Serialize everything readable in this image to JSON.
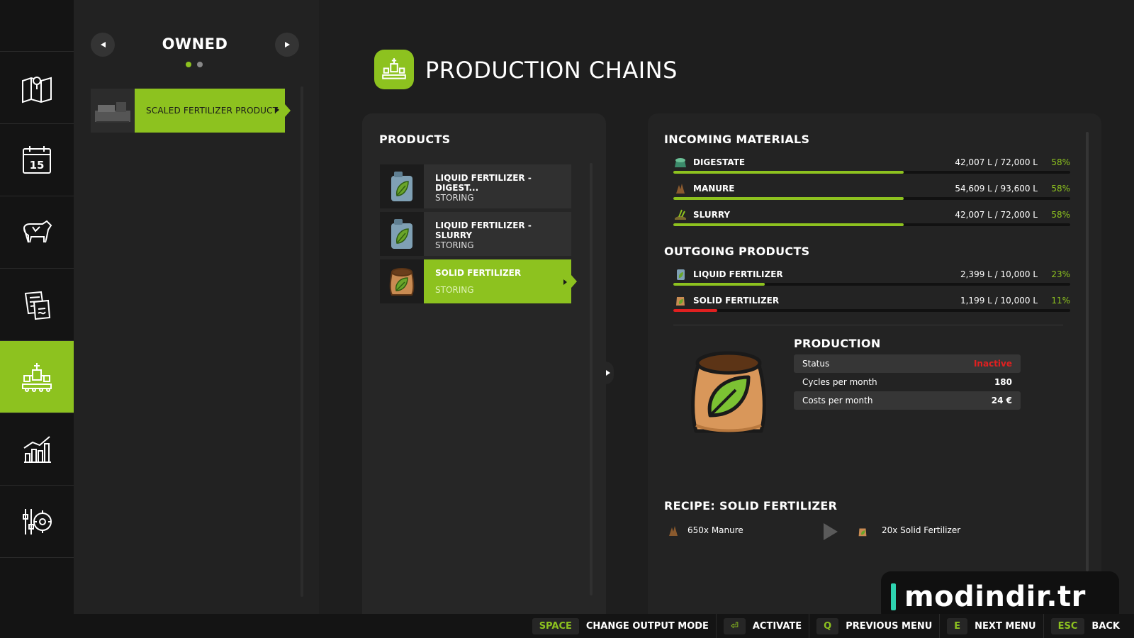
{
  "sidebar": {
    "items": [
      {
        "icon": "map-icon"
      },
      {
        "icon": "calendar-icon",
        "text": "15"
      },
      {
        "icon": "cow-icon"
      },
      {
        "icon": "contracts-icon"
      },
      {
        "icon": "production-icon"
      },
      {
        "icon": "statistics-icon"
      },
      {
        "icon": "settings-icon"
      }
    ],
    "active_index": 4
  },
  "owned": {
    "title": "OWNED",
    "page_count": 2,
    "active_page": 1,
    "item_label": "SCALED FERTILIZER PRODUCT"
  },
  "header": {
    "title": "PRODUCTION CHAINS"
  },
  "products": {
    "title": "PRODUCTS",
    "items": [
      {
        "name": "LIQUID FERTILIZER - DIGEST...",
        "status": "STORING",
        "icon": "liquid-fertilizer-icon"
      },
      {
        "name": "LIQUID FERTILIZER - SLURRY",
        "status": "STORING",
        "icon": "liquid-fertilizer-icon"
      },
      {
        "name": "SOLID FERTILIZER",
        "status": "STORING",
        "icon": "solid-fertilizer-icon",
        "active": true
      }
    ]
  },
  "incoming": {
    "title": "INCOMING MATERIALS",
    "items": [
      {
        "name": "DIGESTATE",
        "amount": "42,007 L / 72,000 L",
        "percent": "58%",
        "fill": 0.58,
        "color": "#8dc21f"
      },
      {
        "name": "MANURE",
        "amount": "54,609 L / 93,600 L",
        "percent": "58%",
        "fill": 0.58,
        "color": "#8dc21f"
      },
      {
        "name": "SLURRY",
        "amount": "42,007 L / 72,000 L",
        "percent": "58%",
        "fill": 0.58,
        "color": "#8dc21f"
      }
    ]
  },
  "outgoing": {
    "title": "OUTGOING PRODUCTS",
    "items": [
      {
        "name": "LIQUID FERTILIZER",
        "amount": "2,399 L / 10,000 L",
        "percent": "23%",
        "fill": 0.23,
        "color": "#8dc21f"
      },
      {
        "name": "SOLID FERTILIZER",
        "amount": "1,199 L / 10,000 L",
        "percent": "11%",
        "fill": 0.11,
        "color": "#e02020"
      }
    ]
  },
  "production": {
    "title": "PRODUCTION",
    "rows": [
      {
        "label": "Status",
        "value": "Inactive"
      },
      {
        "label": "Cycles per month",
        "value": "180"
      },
      {
        "label": "Costs per month",
        "value": "24 €"
      }
    ]
  },
  "recipe": {
    "title": "RECIPE: SOLID FERTILIZER",
    "input": "650x Manure",
    "output": "20x Solid Fertilizer"
  },
  "watermark": {
    "text": "modindir.tr"
  },
  "hints": [
    {
      "key": "SPACE",
      "label": "CHANGE OUTPUT MODE"
    },
    {
      "key": "⏎",
      "label": "ACTIVATE"
    },
    {
      "key": "Q",
      "label": "PREVIOUS MENU"
    },
    {
      "key": "E",
      "label": "NEXT MENU"
    },
    {
      "key": "ESC",
      "label": "BACK"
    }
  ],
  "colors": {
    "accent": "#8dc21f",
    "danger": "#e02020",
    "background": "#1e1e1e"
  }
}
